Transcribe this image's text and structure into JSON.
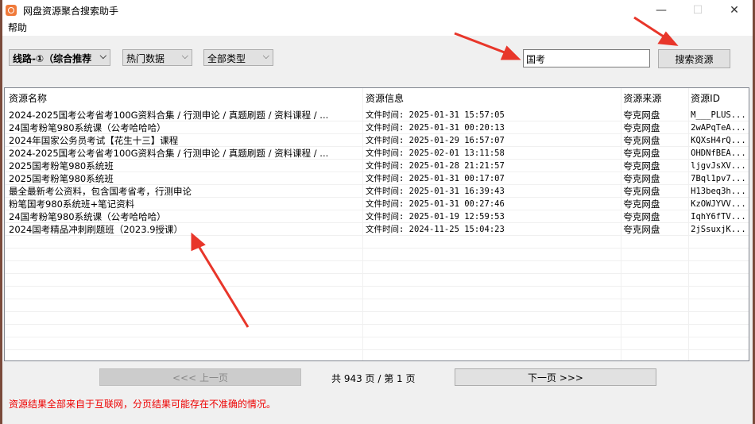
{
  "window": {
    "title": "网盘资源聚合搜索助手",
    "minimize": "—",
    "maximize": "☐",
    "close": "✕"
  },
  "menu": {
    "help": "帮助"
  },
  "toolbar": {
    "route": "线路-①（综合推荐",
    "hot": "热门数据",
    "type": "全部类型",
    "search_value": "国考",
    "search_button": "搜索资源"
  },
  "table": {
    "columns": [
      "资源名称",
      "资源信息",
      "资源来源",
      "资源ID"
    ],
    "rows": [
      {
        "name": "2024-2025国考公考省考100G资料合集 / 行测申论 / 真题刷题 / 资料课程 / ...",
        "info": "文件时间: 2025-01-31 15:57:05",
        "source": "夸克网盘",
        "id": "M___PLUS..."
      },
      {
        "name": "24国考粉笔980系统课（公考哈哈哈）",
        "info": "文件时间: 2025-01-31 00:20:13",
        "source": "夸克网盘",
        "id": "2wAPqTeA..."
      },
      {
        "name": "2024年国家公务员考试【花生十三】课程",
        "info": "文件时间: 2025-01-29 16:57:07",
        "source": "夸克网盘",
        "id": "KQXsH4rQ..."
      },
      {
        "name": "2024-2025国考公考省考100G资料合集 / 行测申论 / 真题刷题 / 资料课程 / ...",
        "info": "文件时间: 2025-02-01 13:11:58",
        "source": "夸克网盘",
        "id": "OHDNfBEA..."
      },
      {
        "name": "2025国考粉笔980系统班",
        "info": "文件时间: 2025-01-28 21:21:57",
        "source": "夸克网盘",
        "id": "ljgvJsXV..."
      },
      {
        "name": "2025国考粉笔980系统班",
        "info": "文件时间: 2025-01-31 00:17:07",
        "source": "夸克网盘",
        "id": "7Bql1pv7..."
      },
      {
        "name": "最全最新考公资料，包含国考省考，行测申论",
        "info": "文件时间: 2025-01-31 16:39:43",
        "source": "夸克网盘",
        "id": "H13beq3h..."
      },
      {
        "name": "粉笔国考980系统班+笔记资料",
        "info": "文件时间: 2025-01-31 00:27:46",
        "source": "夸克网盘",
        "id": "KzOWJYVV..."
      },
      {
        "name": "24国考粉笔980系统课（公考哈哈哈）",
        "info": "文件时间: 2025-01-19 12:59:53",
        "source": "夸克网盘",
        "id": "IqhY6fTV..."
      },
      {
        "name": "2024国考精品冲刺刷题班（2023.9授课）",
        "info": "文件时间: 2024-11-25 15:04:23",
        "source": "夸克网盘",
        "id": "2jSsuxjK..."
      }
    ]
  },
  "pager": {
    "prev": "<<<  上一页",
    "next": "下一页  >>>",
    "info": "共 943 页 / 第 1 页"
  },
  "notice": "资源结果全部来自于互联网，分页结果可能存在不准确的情况。",
  "colors": {
    "arrow": "#e8362a",
    "notice": "#e00000"
  }
}
